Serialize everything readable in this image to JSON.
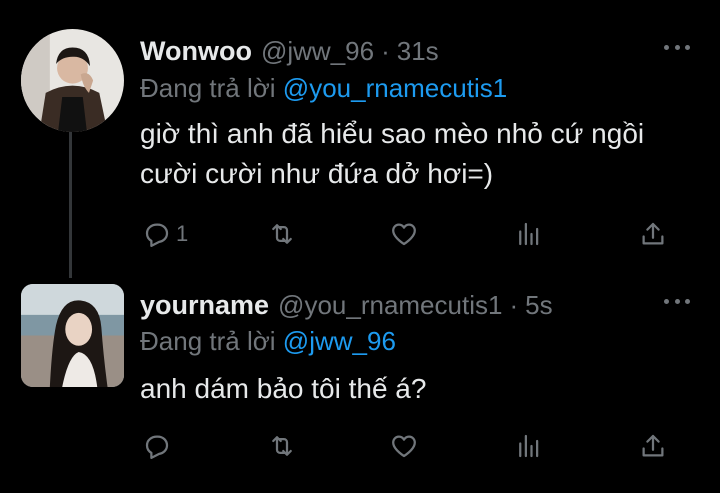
{
  "tweets": [
    {
      "name": "Wonwoo",
      "handle": "@jww_96",
      "time": "31s",
      "reply_prefix": "Đang trả lời",
      "reply_mention": "@you_rnamecutis1",
      "text": "giờ thì anh đã hiểu sao mèo nhỏ cứ ngồi cười cười như đứa dở hơi=)",
      "reply_count": "1",
      "icons": [
        "reply-icon",
        "retweet-icon",
        "like-icon",
        "stats-icon",
        "share-icon",
        "more-icon"
      ]
    },
    {
      "name": "yourname",
      "handle": "@you_rnamecutis1",
      "time": "5s",
      "reply_prefix": "Đang trả lời",
      "reply_mention": "@jww_96",
      "text": "anh dám bảo tôi thế á?",
      "reply_count": "",
      "icons": [
        "reply-icon",
        "retweet-icon",
        "like-icon",
        "stats-icon",
        "share-icon",
        "more-icon"
      ]
    }
  ],
  "colors": {
    "background": "#000000",
    "text": "#e7e9ea",
    "muted": "#71767b",
    "mention": "#1d9bf0",
    "thread_line": "#333639"
  }
}
